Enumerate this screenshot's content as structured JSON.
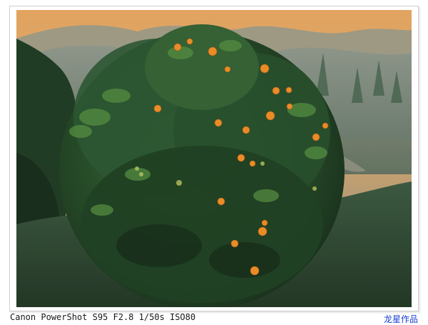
{
  "photo": {
    "alt": "Mandarin orange tree on a misty hillside",
    "colors": {
      "sky_top": "#f2b368",
      "sky_glow": "#f6c080",
      "haze": "#7f8e82",
      "foliage_dark": "#0f2a14",
      "foliage_mid": "#1f4a22",
      "foliage_light": "#4f8a3a",
      "fruit": "#f08a1e"
    }
  },
  "caption": {
    "exif": "Canon PowerShot S95 F2.8 1/50s ISO80",
    "signature": "龙星作品"
  }
}
